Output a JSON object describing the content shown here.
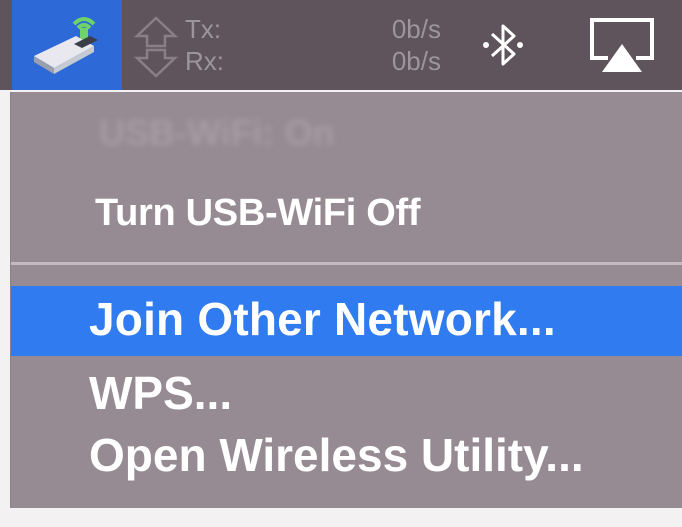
{
  "menubar": {
    "usb_wifi_icon": "usb-wifi-adapter-icon",
    "network": {
      "arrows_icon": "upload-download-arrows-icon",
      "tx_label": "Tx:",
      "tx_value": "0b/s",
      "rx_label": "Rx:",
      "rx_value": "0b/s"
    },
    "bluetooth_icon": "bluetooth-icon",
    "airplay_icon": "airplay-icon"
  },
  "menu": {
    "status_item": "USB-WiFi: On",
    "items": [
      {
        "label": "Turn USB-WiFi Off"
      },
      {
        "label": "Join Other Network..."
      },
      {
        "label": "WPS..."
      },
      {
        "label": "Open Wireless Utility..."
      }
    ]
  },
  "colors": {
    "menubar": "#5f545c",
    "highlight": "#2f7bef",
    "menu_background": "#978b93"
  }
}
